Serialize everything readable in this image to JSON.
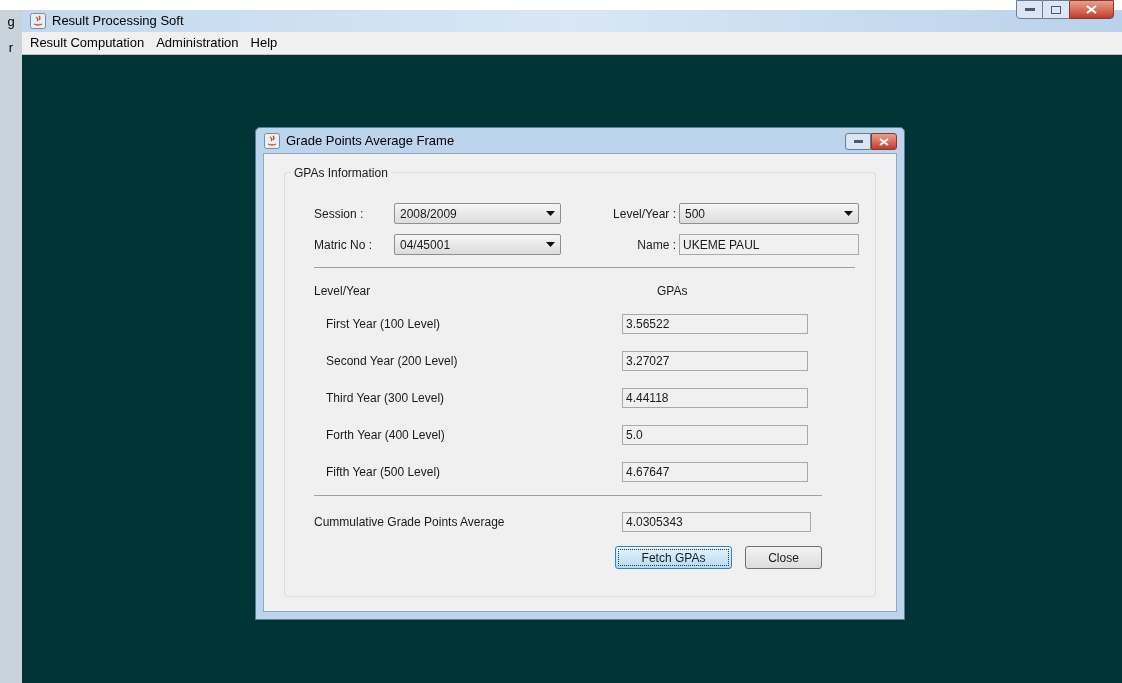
{
  "background_window": {
    "fragments": [
      "g",
      "r"
    ]
  },
  "window": {
    "title": "Result Processing Soft"
  },
  "menu": [
    "Result Computation",
    "Administration",
    "Help"
  ],
  "dialog": {
    "title": "Grade Points Average Frame",
    "group_title": "GPAs Information",
    "fields": [
      {
        "label": "Session :",
        "kind": "combo",
        "value": "2008/2009"
      },
      {
        "label": "Level/Year :",
        "kind": "combo",
        "value": "500"
      },
      {
        "label": "Matric No :",
        "kind": "combo",
        "value": "04/45001"
      },
      {
        "label": "Name :",
        "kind": "text",
        "value": "UKEME PAUL"
      }
    ],
    "table": {
      "columns": [
        "Level/Year",
        "GPAs"
      ],
      "rows": [
        {
          "label": "First Year (100 Level)",
          "value": "3.56522"
        },
        {
          "label": "Second Year (200 Level)",
          "value": "3.27027"
        },
        {
          "label": "Third Year (300 Level)",
          "value": "4.44118"
        },
        {
          "label": "Forth Year (400 Level)",
          "value": "5.0"
        },
        {
          "label": "Fifth Year (500 Level)",
          "value": "4.67647"
        }
      ]
    },
    "cumulative": {
      "label": "Cummulative Grade Points Average",
      "value": "4.0305343"
    },
    "buttons": [
      {
        "label": "Fetch GPAs",
        "focused": true
      },
      {
        "label": "Close",
        "focused": false
      }
    ]
  }
}
